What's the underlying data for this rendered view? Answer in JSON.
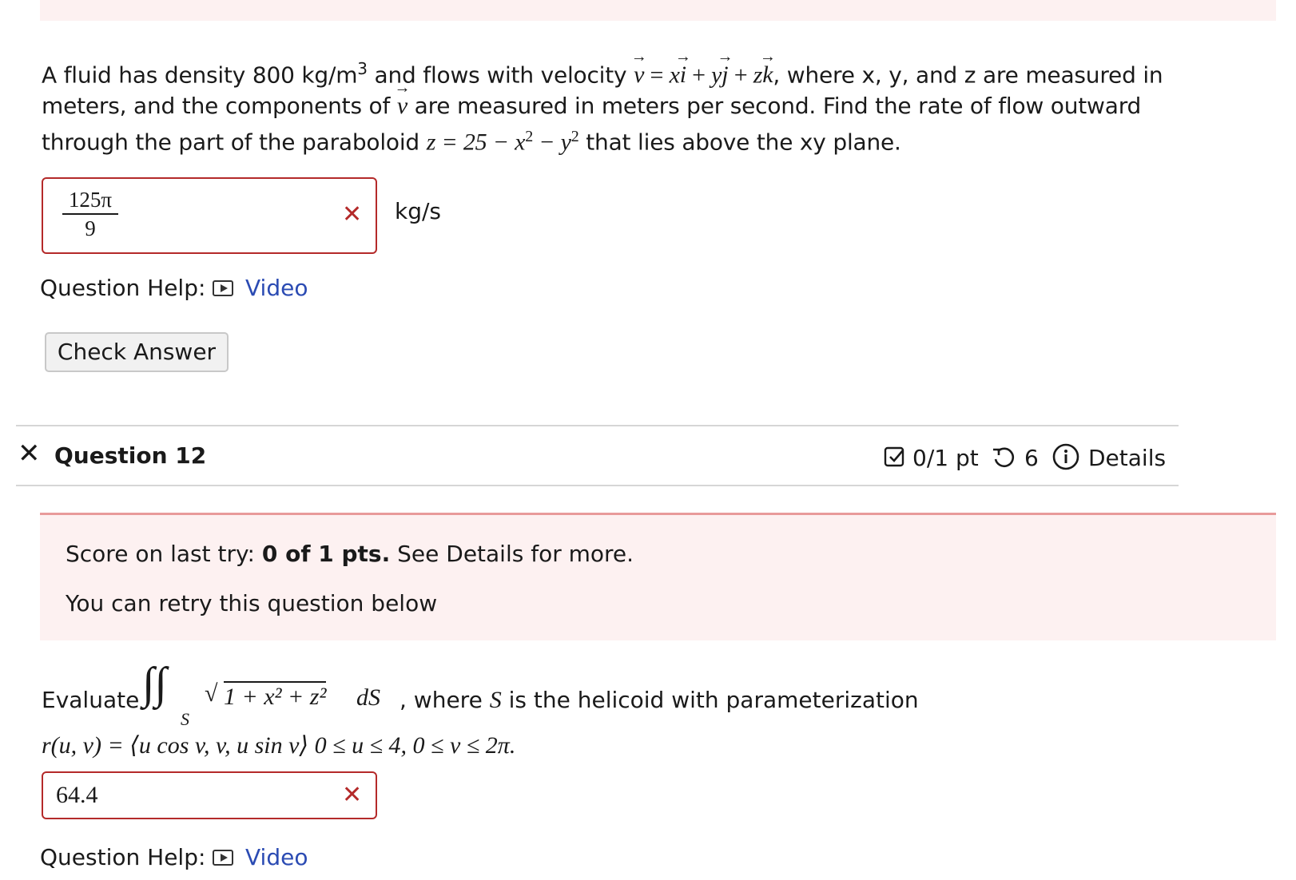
{
  "question_prev": {
    "text_parts": {
      "p1": "A fluid has density 800 kg/m",
      "p1_sup": "3",
      "p2": " and flows with velocity ",
      "v": "v",
      "eq": " = ",
      "xi_x": "x",
      "xi_i": "i",
      "plus": " + ",
      "yj_y": "y",
      "yj_j": "j",
      "zk_z": "z",
      "zk_k": "k",
      "p3": ", where x, y, and z are measured in",
      "line2": "meters, and the components of ",
      "line2b": " are measured in meters per second. Find the rate of flow outward",
      "line3a": "through the part of the paraboloid ",
      "line3_eq": "z = 25 − x",
      "line3_sup": "2",
      "line3_minus": " − y",
      "line3_sup2": "2",
      "line3b": " that lies above the xy plane."
    },
    "answer": {
      "numerator": "125π",
      "denominator": "9"
    },
    "unit": "kg/s",
    "help_label": "Question Help:",
    "video_label": "Video",
    "check_answer": "Check Answer"
  },
  "question12": {
    "title": "Question 12",
    "score": "0/1 pt",
    "retries": "6",
    "details": "Details",
    "banner": {
      "line1_a": "Score on last try: ",
      "line1_b": "0 of 1 pts.",
      "line1_c": " See Details for more.",
      "line2": "You can retry this question below"
    },
    "prompt": {
      "evaluate": "Evaluate",
      "integrand": "1 + x² + z²",
      "ds": "dS",
      "sub": "S",
      "after": ", where ",
      "S": "S",
      "after2": " is the helicoid with parameterization",
      "param": "r(u, v) = ⟨u cos v, v, u sin v⟩  0 ≤ u ≤ 4,  0 ≤ v ≤ 2π."
    },
    "answer_value": "64.4",
    "help_label": "Question Help:",
    "video_label": "Video"
  },
  "colors": {
    "error": "#b42a2a",
    "link": "#2b4bb3",
    "banner_bg": "#fdf1f1"
  }
}
